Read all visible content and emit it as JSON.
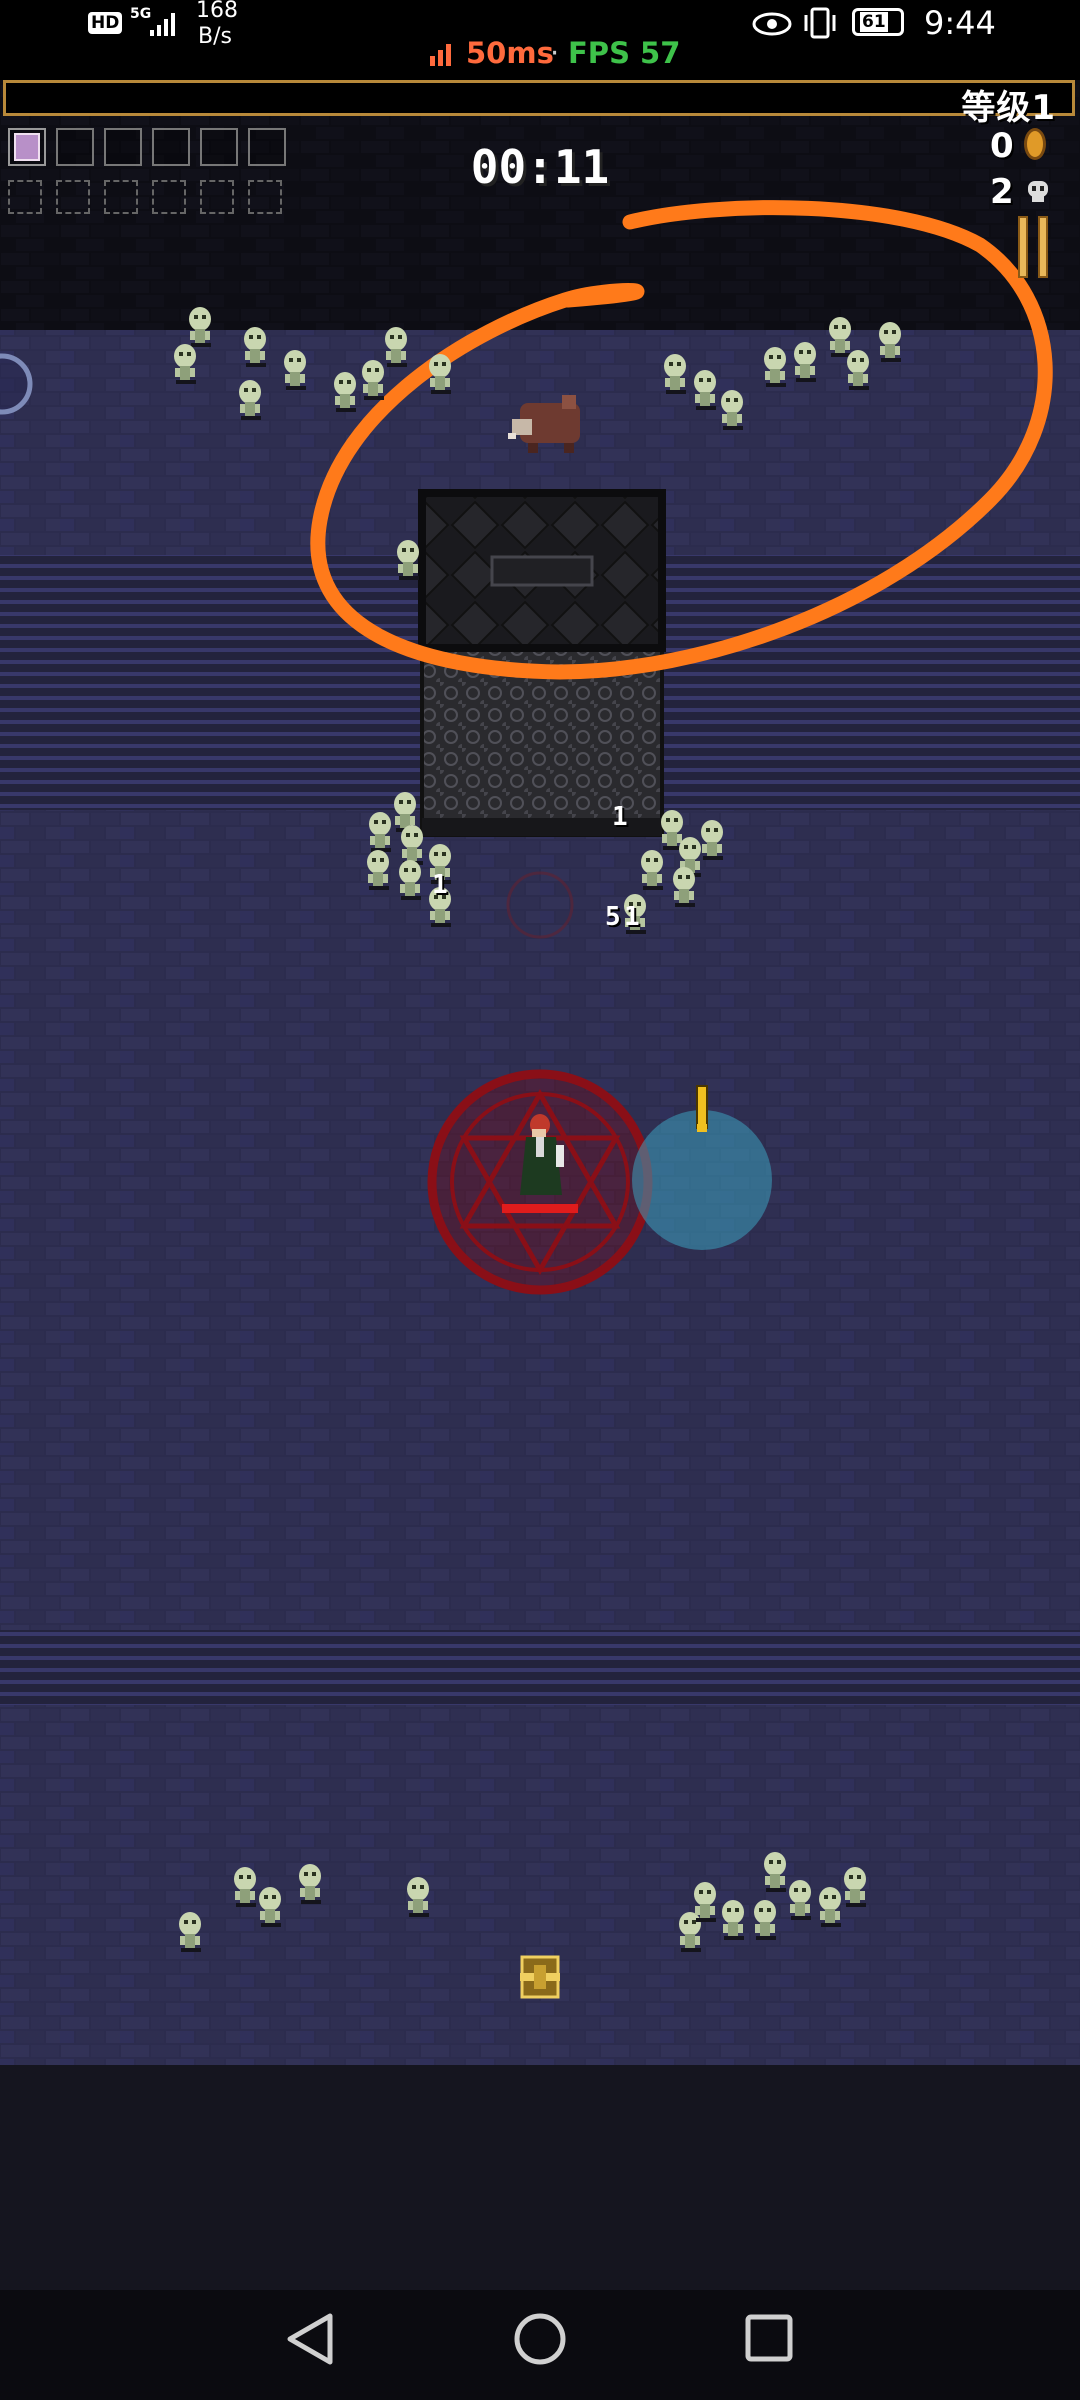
{
  "status_bar": {
    "hd_badge": "HD",
    "network": "5G",
    "speed_value": "168",
    "speed_unit": "B/s",
    "ping": "50ms",
    "separator": "·",
    "fps": "FPS 57",
    "battery": "61",
    "time": "9:44",
    "colors": {
      "ping": "#ff6a3d",
      "fps": "#3ec24a"
    }
  },
  "hud": {
    "level_label": "等级1",
    "xp_progress": 0,
    "timer": "00:11",
    "coins": "0",
    "kills": "2",
    "weapon_slot_icons": [
      "spellbook-icon"
    ],
    "weapon_slots_total": 6,
    "passive_slots_total": 6
  },
  "arena": {
    "floor_color": "#2b2b4c",
    "damage_numbers": [
      "1",
      "1",
      "5",
      "1"
    ],
    "player_health": 1,
    "annotation_color": "#ff7a1a"
  },
  "nav_bar": {
    "icons": [
      "back-triangle-icon",
      "home-circle-icon",
      "recents-square-icon"
    ]
  }
}
